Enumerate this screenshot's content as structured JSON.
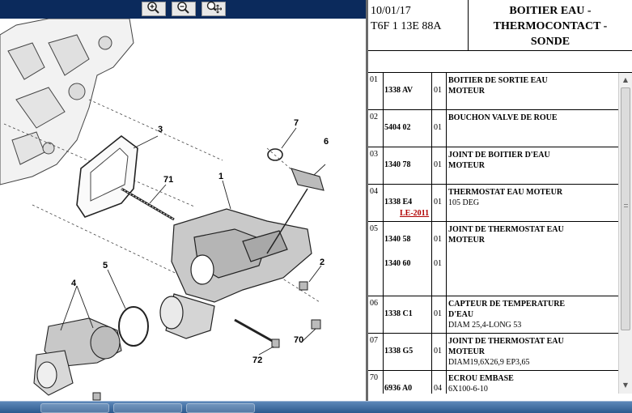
{
  "header": {
    "date": "10/01/17",
    "code": "T6F 1 13E 88A",
    "title_lines": [
      "BOITIER EAU -",
      "THERMOCONTACT -",
      "SONDE"
    ]
  },
  "toolbar": {
    "zoom_in_icon": "zoom-in-icon",
    "zoom_out_icon": "zoom-out-icon",
    "zoom_fit_icon": "zoom-fit-icon"
  },
  "diagram": {
    "callouts": [
      "1",
      "2",
      "3",
      "4",
      "5",
      "6",
      "7",
      "70",
      "71",
      "72"
    ]
  },
  "parts": [
    {
      "num": "01",
      "refs": [
        "1338 AV"
      ],
      "qtys": [
        "01"
      ],
      "desc": [
        "BOITIER DE SORTIE EAU",
        "MOTEUR"
      ],
      "extra": []
    },
    {
      "num": "02",
      "refs": [
        "5404 02"
      ],
      "qtys": [
        "01"
      ],
      "desc": [
        "BOUCHON VALVE DE ROUE"
      ],
      "extra": []
    },
    {
      "num": "03",
      "refs": [
        "1340 78"
      ],
      "qtys": [
        "01"
      ],
      "desc": [
        "JOINT DE BOITIER D'EAU",
        "MOTEUR"
      ],
      "extra": []
    },
    {
      "num": "04",
      "refs": [
        "1338 E4"
      ],
      "qtys": [
        "01"
      ],
      "link": "LE-2011",
      "desc": [
        "THERMOSTAT EAU MOTEUR"
      ],
      "extra": [
        "105 DEG"
      ]
    },
    {
      "num": "05",
      "refs": [
        "1340 58",
        "1340 60"
      ],
      "qtys": [
        "01",
        "01"
      ],
      "desc": [
        "JOINT DE THERMOSTAT EAU",
        "MOTEUR"
      ],
      "extra": []
    },
    {
      "num": "06",
      "refs": [
        "1338 C1"
      ],
      "qtys": [
        "01"
      ],
      "desc": [
        "CAPTEUR DE TEMPERATURE",
        "D'EAU"
      ],
      "extra": [
        "DIAM 25,4-LONG 53"
      ]
    },
    {
      "num": "07",
      "refs": [
        "1338 G5"
      ],
      "qtys": [
        "01"
      ],
      "desc": [
        "JOINT DE THERMOSTAT EAU",
        "MOTEUR"
      ],
      "extra": [
        "DIAM19,6X26,9 EP3,65"
      ]
    },
    {
      "num": "70",
      "refs": [
        "6936 A0"
      ],
      "qtys": [
        "04"
      ],
      "desc": [
        "ECROU EMBASE"
      ],
      "extra": [
        "6X100-6-10"
      ]
    }
  ],
  "colors": {
    "toolbar_bg": "#0b2a5c",
    "link": "#b00000"
  }
}
